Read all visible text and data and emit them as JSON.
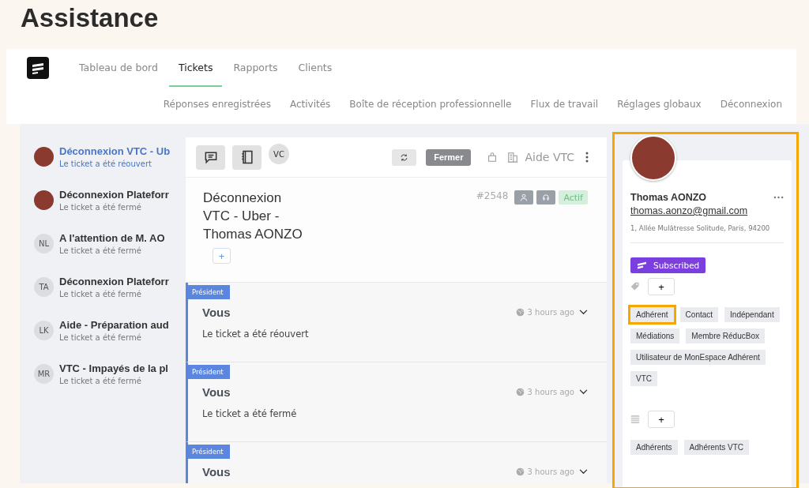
{
  "page_title": "Assistance",
  "tabs": [
    {
      "label": "Tableau de bord",
      "selected": false
    },
    {
      "label": "Tickets",
      "selected": true
    },
    {
      "label": "Rapports",
      "selected": false
    },
    {
      "label": "Clients",
      "selected": false
    }
  ],
  "sub_menu": [
    "Réponses enregistrées",
    "Activités",
    "Boîte de réception professionnelle",
    "Flux de travail",
    "Réglages globaux",
    "Déconnexion"
  ],
  "tickets": [
    {
      "title": "Déconnexion VTC - Ub",
      "status": "Le ticket a été réouvert",
      "kind": "photo",
      "selected": true
    },
    {
      "title": "Déconnexion Plateforr",
      "status": "Le ticket a été fermé",
      "kind": "photo",
      "selected": false
    },
    {
      "title": "A l'attention de M. AO",
      "status": "Le ticket a été fermé",
      "kind": "initials",
      "avatar": "NL",
      "selected": false
    },
    {
      "title": "Déconnexion Plateforr",
      "status": "Le ticket a été fermé",
      "kind": "initials",
      "avatar": "TA",
      "selected": false
    },
    {
      "title": "Aide - Préparation aud",
      "status": "Le ticket a été fermé",
      "kind": "initials",
      "avatar": "LK",
      "selected": false
    },
    {
      "title": "VTC - Impayés de la pl",
      "status": "Le ticket a été fermé",
      "kind": "initials",
      "avatar": "MR",
      "selected": false
    }
  ],
  "toolbar": {
    "assignee": "VC",
    "close_button": "Fermer",
    "mailbox": "Aide VTC"
  },
  "ticket": {
    "title": "Déconnexion VTC - Uber - Thomas AONZO",
    "number": "#2548",
    "status": "Actif",
    "add": "+"
  },
  "messages": [
    {
      "badge": "Président",
      "author": "Vous",
      "time": "3 hours ago",
      "body": "Le ticket a été réouvert"
    },
    {
      "badge": "Président",
      "author": "Vous",
      "time": "3 hours ago",
      "body": "Le ticket a été fermé"
    },
    {
      "badge": "Président",
      "author": "Vous",
      "time": "3 hours ago"
    }
  ],
  "customer": {
    "highlighted": true,
    "name": "Thomas AONZO",
    "email": "thomas.aonzo@gmail.com",
    "address": "1, Allée Mulâtresse Solitude, Paris, 94200",
    "subscription": "Subscribed",
    "add_tag": "+",
    "tags": [
      {
        "label": "Adhérent",
        "highlighted": true
      },
      {
        "label": "Contact",
        "highlighted": false
      },
      {
        "label": "Indépendant",
        "highlighted": false
      },
      {
        "label": "Médiations",
        "highlighted": false
      },
      {
        "label": "Membre RéducBox",
        "highlighted": false
      },
      {
        "label": "Utilisateur de MonEspace Adhérent",
        "highlighted": false
      },
      {
        "label": "VTC",
        "highlighted": false
      }
    ],
    "add_list": "+",
    "lists": [
      "Adhérents",
      "Adhérents VTC"
    ]
  }
}
